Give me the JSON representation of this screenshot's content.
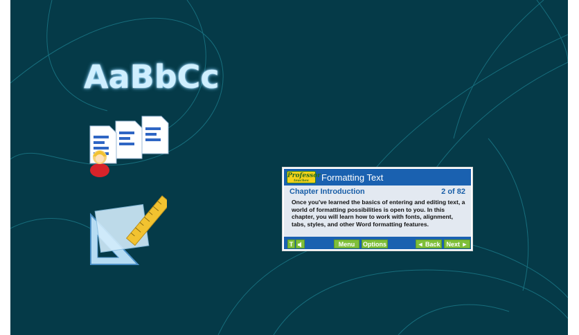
{
  "illustration": {
    "font_sample_text": "AaBbCc",
    "docs_icon": "documents-with-user-icon",
    "triangle_icon": "set-square-and-ruler-icon"
  },
  "tutorial_panel": {
    "logo_text": "Professor",
    "logo_subtext": "teaches",
    "title": "Formatting Text",
    "chapter_label": "Chapter Introduction",
    "page_counter": "2 of 82",
    "body": "Once you've learned the basics of entering and editing text, a world of formatting possibilities is open to you. In this chapter, you will learn how to work with fonts, alignment, tabs, styles, and other Word formatting features.",
    "buttons": {
      "text_toggle": "T",
      "audio_icon": "speaker-icon",
      "menu": "Menu",
      "options": "Options",
      "back": "◄ Back",
      "next": "Next ►"
    }
  },
  "colors": {
    "background": "#053a48",
    "panel_blue": "#1a61b0",
    "button_green": "#7fbf3a"
  }
}
